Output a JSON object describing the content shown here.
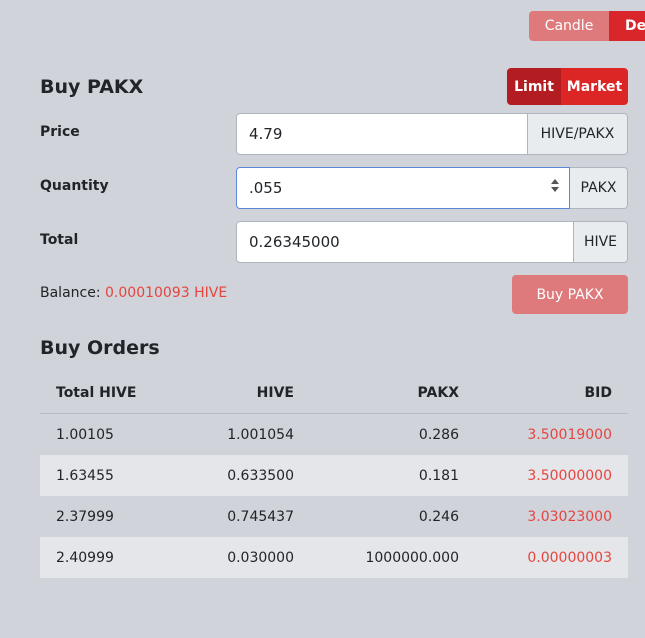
{
  "chart_toggle": {
    "candle": "Candle",
    "depth": "De"
  },
  "buy_panel": {
    "title": "Buy PAKX",
    "order_types": {
      "limit": "Limit",
      "market": "Market"
    },
    "price": {
      "label": "Price",
      "value": "4.79",
      "unit": "HIVE/PAKX"
    },
    "quantity": {
      "label": "Quantity",
      "value": ".055",
      "unit": "PAKX"
    },
    "total": {
      "label": "Total",
      "value": "0.26345000",
      "unit": "HIVE"
    },
    "balance_label": "Balance:",
    "balance_value": "0.00010093 HIVE",
    "buy_button": "Buy PAKX"
  },
  "buy_orders": {
    "title": "Buy Orders",
    "columns": [
      "Total HIVE",
      "HIVE",
      "PAKX",
      "BID"
    ],
    "rows": [
      [
        "1.00105",
        "1.001054",
        "0.286",
        "3.50019000"
      ],
      [
        "1.63455",
        "0.633500",
        "0.181",
        "3.50000000"
      ],
      [
        "2.37999",
        "0.745437",
        "0.246",
        "3.03023000"
      ],
      [
        "2.40999",
        "0.030000",
        "1000000.000",
        "0.00000003"
      ]
    ]
  }
}
